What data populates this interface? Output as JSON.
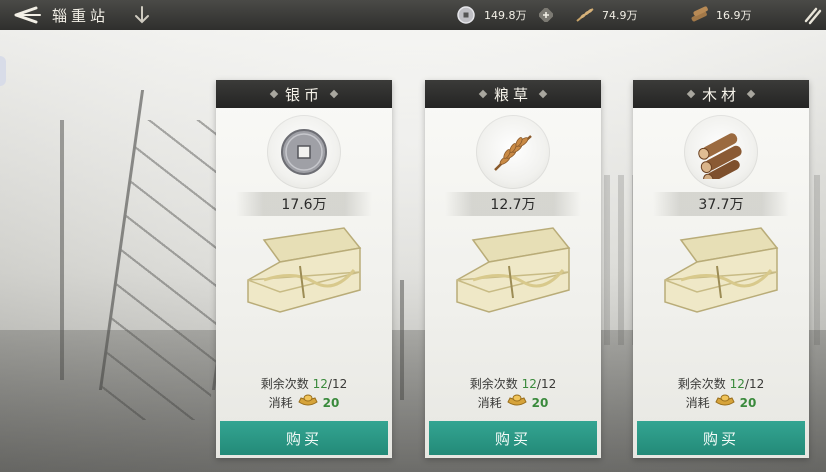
{
  "header": {
    "title": "辎重站",
    "resources": [
      {
        "name": "coin",
        "icon": "silver-coin-icon",
        "value": "149.8万"
      },
      {
        "name": "grain",
        "icon": "grain-icon",
        "value": "74.9万"
      },
      {
        "name": "wood",
        "icon": "wood-icon",
        "value": "16.9万"
      }
    ]
  },
  "cards": [
    {
      "title": "银币",
      "icon": "silver-coin-icon",
      "amount": "17.6万",
      "remaining_label": "剩余次数",
      "remaining_current": "12",
      "remaining_sep": "/",
      "remaining_total": "12",
      "cost_label": "消耗",
      "cost_value": "20",
      "cost_icon": "gold-ingot-icon",
      "buy_label": "购买"
    },
    {
      "title": "粮草",
      "icon": "grain-icon",
      "amount": "12.7万",
      "remaining_label": "剩余次数",
      "remaining_current": "12",
      "remaining_sep": "/",
      "remaining_total": "12",
      "cost_label": "消耗",
      "cost_value": "20",
      "cost_icon": "gold-ingot-icon",
      "buy_label": "购买"
    },
    {
      "title": "木材",
      "icon": "wood-icon",
      "amount": "37.7万",
      "remaining_label": "剩余次数",
      "remaining_current": "12",
      "remaining_sep": "/",
      "remaining_total": "12",
      "cost_label": "消耗",
      "cost_value": "20",
      "cost_icon": "gold-ingot-icon",
      "buy_label": "购买"
    }
  ],
  "colors": {
    "accent_button": "#2a9683",
    "highlight_number": "#3a8a3c",
    "header_bar": "#2f2f2d"
  }
}
